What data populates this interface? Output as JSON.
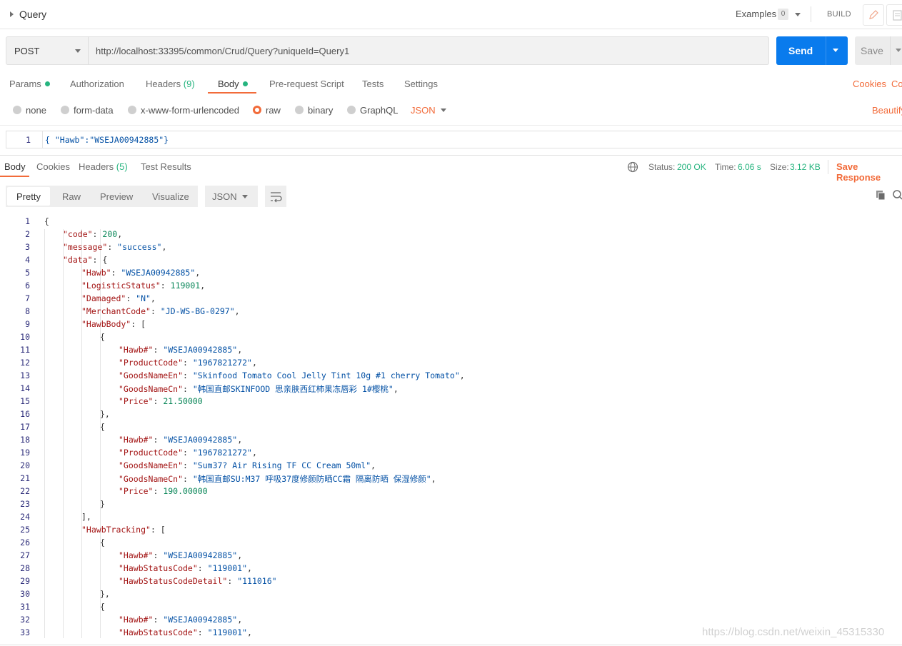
{
  "header": {
    "title": "Query",
    "examples_label": "Examples",
    "examples_count": "0",
    "build_label": "BUILD"
  },
  "request": {
    "method": "POST",
    "url": "http://localhost:33395/common/Crud/Query?uniqueId=Query1",
    "send_label": "Send",
    "save_label": "Save"
  },
  "request_tabs": {
    "params": "Params",
    "authorization": "Authorization",
    "headers": "Headers",
    "headers_count": "(9)",
    "body": "Body",
    "prerequest": "Pre-request Script",
    "tests": "Tests",
    "settings": "Settings",
    "cookies": "Cookies",
    "code": "Co"
  },
  "body_options": {
    "none": "none",
    "form_data": "form-data",
    "urlencoded": "x-www-form-urlencoded",
    "raw": "raw",
    "binary": "binary",
    "graphql": "GraphQL",
    "format": "JSON",
    "beautify": "Beautify"
  },
  "request_body": {
    "line_no": "1",
    "text": "{ \"Hawb\":\"WSEJA00942885\"}"
  },
  "response_tabs": {
    "body": "Body",
    "cookies": "Cookies",
    "headers": "Headers",
    "headers_count": "(5)",
    "test_results": "Test Results",
    "status_label": "Status:",
    "status_value": "200 OK",
    "time_label": "Time:",
    "time_value": "6.06 s",
    "size_label": "Size:",
    "size_value": "3.12 KB",
    "save_response": "Save Response"
  },
  "view_modes": {
    "pretty": "Pretty",
    "raw": "Raw",
    "preview": "Preview",
    "visualize": "Visualize",
    "format": "JSON"
  },
  "colors": {
    "accent": "#f26b3a",
    "send": "#097bed",
    "status_green": "#26b47f"
  },
  "response_lines": [
    {
      "n": "1",
      "i": 0,
      "t": [
        [
          "p",
          "{"
        ]
      ]
    },
    {
      "n": "2",
      "i": 1,
      "t": [
        [
          "k",
          "\"code\""
        ],
        [
          "p",
          ": "
        ],
        [
          "n",
          "200"
        ],
        [
          "p",
          ","
        ]
      ]
    },
    {
      "n": "3",
      "i": 1,
      "t": [
        [
          "k",
          "\"message\""
        ],
        [
          "p",
          ": "
        ],
        [
          "s",
          "\"success\""
        ],
        [
          "p",
          ","
        ]
      ]
    },
    {
      "n": "4",
      "i": 1,
      "t": [
        [
          "k",
          "\"data\""
        ],
        [
          "p",
          ": {"
        ]
      ]
    },
    {
      "n": "5",
      "i": 2,
      "t": [
        [
          "k",
          "\"Hawb\""
        ],
        [
          "p",
          ": "
        ],
        [
          "s",
          "\"WSEJA00942885\""
        ],
        [
          "p",
          ","
        ]
      ]
    },
    {
      "n": "6",
      "i": 2,
      "t": [
        [
          "k",
          "\"LogisticStatus\""
        ],
        [
          "p",
          ": "
        ],
        [
          "n",
          "119001"
        ],
        [
          "p",
          ","
        ]
      ]
    },
    {
      "n": "7",
      "i": 2,
      "t": [
        [
          "k",
          "\"Damaged\""
        ],
        [
          "p",
          ": "
        ],
        [
          "s",
          "\"N\""
        ],
        [
          "p",
          ","
        ]
      ]
    },
    {
      "n": "8",
      "i": 2,
      "t": [
        [
          "k",
          "\"MerchantCode\""
        ],
        [
          "p",
          ": "
        ],
        [
          "s",
          "\"JD-WS-BG-0297\""
        ],
        [
          "p",
          ","
        ]
      ]
    },
    {
      "n": "9",
      "i": 2,
      "t": [
        [
          "k",
          "\"HawbBody\""
        ],
        [
          "p",
          ": ["
        ]
      ]
    },
    {
      "n": "10",
      "i": 3,
      "t": [
        [
          "p",
          "{"
        ]
      ]
    },
    {
      "n": "11",
      "i": 4,
      "t": [
        [
          "k",
          "\"Hawb#\""
        ],
        [
          "p",
          ": "
        ],
        [
          "s",
          "\"WSEJA00942885\""
        ],
        [
          "p",
          ","
        ]
      ]
    },
    {
      "n": "12",
      "i": 4,
      "t": [
        [
          "k",
          "\"ProductCode\""
        ],
        [
          "p",
          ": "
        ],
        [
          "s",
          "\"1967821272\""
        ],
        [
          "p",
          ","
        ]
      ]
    },
    {
      "n": "13",
      "i": 4,
      "t": [
        [
          "k",
          "\"GoodsNameEn\""
        ],
        [
          "p",
          ": "
        ],
        [
          "s",
          "\"Skinfood Tomato Cool Jelly Tint 10g #1 cherry Tomato\""
        ],
        [
          "p",
          ","
        ]
      ]
    },
    {
      "n": "14",
      "i": 4,
      "t": [
        [
          "k",
          "\"GoodsNameCn\""
        ],
        [
          "p",
          ": "
        ],
        [
          "s",
          "\"韩国直邮SKINFOOD 思亲肤西红柿果冻唇彩 1#樱桃\""
        ],
        [
          "p",
          ","
        ]
      ]
    },
    {
      "n": "15",
      "i": 4,
      "t": [
        [
          "k",
          "\"Price\""
        ],
        [
          "p",
          ": "
        ],
        [
          "n",
          "21.50000"
        ]
      ]
    },
    {
      "n": "16",
      "i": 3,
      "t": [
        [
          "p",
          "},"
        ]
      ]
    },
    {
      "n": "17",
      "i": 3,
      "t": [
        [
          "p",
          "{"
        ]
      ]
    },
    {
      "n": "18",
      "i": 4,
      "t": [
        [
          "k",
          "\"Hawb#\""
        ],
        [
          "p",
          ": "
        ],
        [
          "s",
          "\"WSEJA00942885\""
        ],
        [
          "p",
          ","
        ]
      ]
    },
    {
      "n": "19",
      "i": 4,
      "t": [
        [
          "k",
          "\"ProductCode\""
        ],
        [
          "p",
          ": "
        ],
        [
          "s",
          "\"1967821272\""
        ],
        [
          "p",
          ","
        ]
      ]
    },
    {
      "n": "20",
      "i": 4,
      "t": [
        [
          "k",
          "\"GoodsNameEn\""
        ],
        [
          "p",
          ": "
        ],
        [
          "s",
          "\"Sum37? Air Rising TF CC Cream 50ml\""
        ],
        [
          "p",
          ","
        ]
      ]
    },
    {
      "n": "21",
      "i": 4,
      "t": [
        [
          "k",
          "\"GoodsNameCn\""
        ],
        [
          "p",
          ": "
        ],
        [
          "s",
          "\"韩国直邮SU:M37 呼吸37度修颜防晒CC霜 隔离防晒 保湿修颜\""
        ],
        [
          "p",
          ","
        ]
      ]
    },
    {
      "n": "22",
      "i": 4,
      "t": [
        [
          "k",
          "\"Price\""
        ],
        [
          "p",
          ": "
        ],
        [
          "n",
          "190.00000"
        ]
      ]
    },
    {
      "n": "23",
      "i": 3,
      "t": [
        [
          "p",
          "}"
        ]
      ]
    },
    {
      "n": "24",
      "i": 2,
      "t": [
        [
          "p",
          "],"
        ]
      ]
    },
    {
      "n": "25",
      "i": 2,
      "t": [
        [
          "k",
          "\"HawbTracking\""
        ],
        [
          "p",
          ": ["
        ]
      ]
    },
    {
      "n": "26",
      "i": 3,
      "t": [
        [
          "p",
          "{"
        ]
      ]
    },
    {
      "n": "27",
      "i": 4,
      "t": [
        [
          "k",
          "\"Hawb#\""
        ],
        [
          "p",
          ": "
        ],
        [
          "s",
          "\"WSEJA00942885\""
        ],
        [
          "p",
          ","
        ]
      ]
    },
    {
      "n": "28",
      "i": 4,
      "t": [
        [
          "k",
          "\"HawbStatusCode\""
        ],
        [
          "p",
          ": "
        ],
        [
          "s",
          "\"119001\""
        ],
        [
          "p",
          ","
        ]
      ]
    },
    {
      "n": "29",
      "i": 4,
      "t": [
        [
          "k",
          "\"HawbStatusCodeDetail\""
        ],
        [
          "p",
          ": "
        ],
        [
          "s",
          "\"111016\""
        ]
      ]
    },
    {
      "n": "30",
      "i": 3,
      "t": [
        [
          "p",
          "},"
        ]
      ]
    },
    {
      "n": "31",
      "i": 3,
      "t": [
        [
          "p",
          "{"
        ]
      ]
    },
    {
      "n": "32",
      "i": 4,
      "t": [
        [
          "k",
          "\"Hawb#\""
        ],
        [
          "p",
          ": "
        ],
        [
          "s",
          "\"WSEJA00942885\""
        ],
        [
          "p",
          ","
        ]
      ]
    },
    {
      "n": "33",
      "i": 4,
      "t": [
        [
          "k",
          "\"HawbStatusCode\""
        ],
        [
          "p",
          ": "
        ],
        [
          "s",
          "\"119001\""
        ],
        [
          "p",
          ","
        ]
      ]
    }
  ],
  "watermark": "https://blog.csdn.net/weixin_45315330"
}
